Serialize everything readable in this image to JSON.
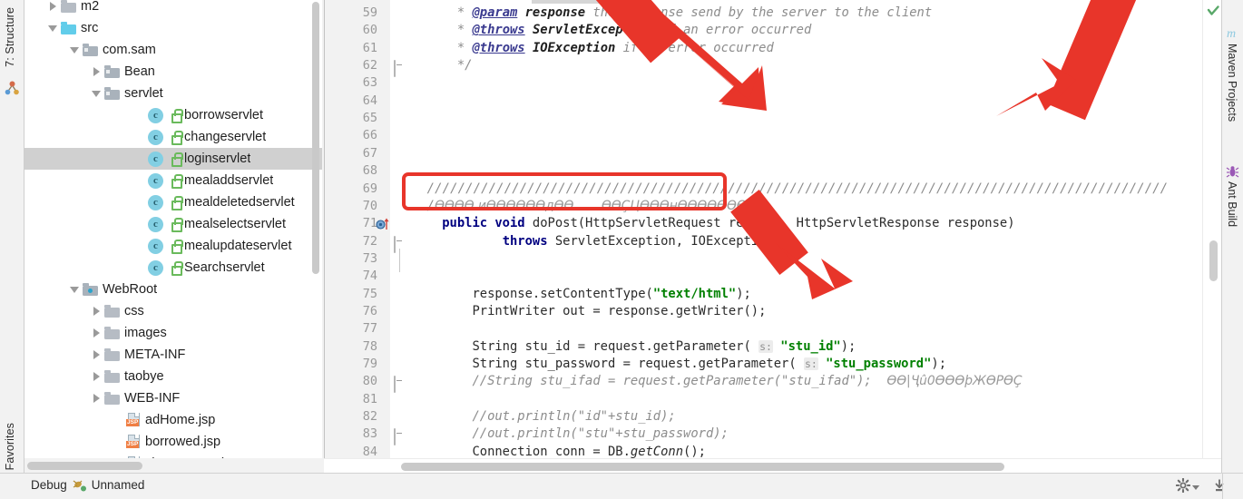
{
  "left_toolwindows": {
    "structure": "7: Structure",
    "favorites": "Favorites",
    "structure_icon": "structure-icon"
  },
  "right_toolwindows": {
    "maven": "Maven Projects",
    "ant": "Ant Build",
    "maven_icon": "maven-m-icon",
    "ant_icon": "ant-bug-icon"
  },
  "project_tree": {
    "items": [
      {
        "label": "m2",
        "indent": 1,
        "twisty": "collapsed",
        "icon": "folder-icon",
        "selected": false,
        "clipped": true
      },
      {
        "label": "src",
        "indent": 1,
        "twisty": "expanded",
        "icon": "folder-source-icon",
        "selected": false
      },
      {
        "label": "com.sam",
        "indent": 2,
        "twisty": "expanded",
        "icon": "package-icon",
        "selected": false
      },
      {
        "label": "Bean",
        "indent": 3,
        "twisty": "collapsed",
        "icon": "package-icon",
        "selected": false
      },
      {
        "label": "servlet",
        "indent": 3,
        "twisty": "expanded",
        "icon": "package-icon",
        "selected": false
      },
      {
        "label": "borrowservlet",
        "indent": 5,
        "twisty": "none",
        "icon": "java-class-icon",
        "selected": false
      },
      {
        "label": "changeservlet",
        "indent": 5,
        "twisty": "none",
        "icon": "java-class-icon",
        "selected": false
      },
      {
        "label": "loginservlet",
        "indent": 5,
        "twisty": "none",
        "icon": "java-class-icon",
        "selected": true
      },
      {
        "label": "mealaddservlet",
        "indent": 5,
        "twisty": "none",
        "icon": "java-class-icon",
        "selected": false
      },
      {
        "label": "mealdeletedservlet",
        "indent": 5,
        "twisty": "none",
        "icon": "java-class-icon",
        "selected": false
      },
      {
        "label": "mealselectservlet",
        "indent": 5,
        "twisty": "none",
        "icon": "java-class-icon",
        "selected": false
      },
      {
        "label": "mealupdateservlet",
        "indent": 5,
        "twisty": "none",
        "icon": "java-class-icon",
        "selected": false
      },
      {
        "label": "Searchservlet",
        "indent": 5,
        "twisty": "none",
        "icon": "java-class-icon",
        "selected": false
      },
      {
        "label": "WebRoot",
        "indent": 2,
        "twisty": "expanded",
        "icon": "folder-webroot-icon",
        "selected": false
      },
      {
        "label": "css",
        "indent": 3,
        "twisty": "collapsed",
        "icon": "folder-icon",
        "selected": false
      },
      {
        "label": "images",
        "indent": 3,
        "twisty": "collapsed",
        "icon": "folder-icon",
        "selected": false
      },
      {
        "label": "META-INF",
        "indent": 3,
        "twisty": "collapsed",
        "icon": "folder-icon",
        "selected": false
      },
      {
        "label": "taobye",
        "indent": 3,
        "twisty": "collapsed",
        "icon": "folder-icon",
        "selected": false
      },
      {
        "label": "WEB-INF",
        "indent": 3,
        "twisty": "collapsed",
        "icon": "folder-icon",
        "selected": false
      },
      {
        "label": "adHome.jsp",
        "indent": 4,
        "twisty": "none",
        "icon": "jsp-file-icon",
        "selected": false
      },
      {
        "label": "borrowed.jsp",
        "indent": 4,
        "twisty": "none",
        "icon": "jsp-file-icon",
        "selected": false
      },
      {
        "label": "changepage.jsp",
        "indent": 4,
        "twisty": "none",
        "icon": "jsp-file-icon",
        "selected": false,
        "clipped": true
      }
    ]
  },
  "editor": {
    "first_line_number": 59,
    "lines": [
      {
        "n": 59,
        "html": "      <span class='cmt'>* </span><span class='tag'>@param</span><span class='cmt'> </span><span class='tagv'>response</span><span class='cmt'> the response send by the server to the client</span>"
      },
      {
        "n": 60,
        "html": "      <span class='cmt'>* </span><span class='tag'>@throws</span><span class='cmt'> </span><span class='tagv'>ServletException</span><span class='cmt'> if an error occurred</span>"
      },
      {
        "n": 61,
        "html": "      <span class='cmt'>* </span><span class='tag'>@throws</span><span class='cmt'> </span><span class='tagv'>IOException</span><span class='cmt'> if an error occurred</span>"
      },
      {
        "n": 62,
        "html": "      <span class='cmt'>*/</span>"
      },
      {
        "n": 63,
        "html": ""
      },
      {
        "n": 64,
        "html": ""
      },
      {
        "n": 65,
        "html": ""
      },
      {
        "n": 66,
        "html": ""
      },
      {
        "n": 67,
        "html": ""
      },
      {
        "n": 68,
        "html": ""
      },
      {
        "n": 69,
        "html": "  <span class='slashes'>////////////////////////////////////////////////////////////////////////////////////////////////</span>"
      },
      {
        "n": 70,
        "html": "  <span class='slashes'>/</span><span class='moji'>ӨӨӨӨ иӨӨӨӨӨӨдӨӨ&nbsp;&nbsp;&nbsp;&nbsp;&nbsp;&nbsp;&nbsp;ӨӨÇЦӨӨӨнӨӨӨӨӨӨӨӨ</span>"
      },
      {
        "n": 71,
        "html": "    <span class='kw'>public void</span> doPost(HttpServletRequest request, HttpServletResponse response)"
      },
      {
        "n": 72,
        "html": "            <span class='kw'>throws</span> ServletException, IOException {"
      },
      {
        "n": 73,
        "html": ""
      },
      {
        "n": 74,
        "html": ""
      },
      {
        "n": 75,
        "html": "        response.setContentType(<span class='str'>\"text/html\"</span>);"
      },
      {
        "n": 76,
        "html": "        PrintWriter out = response.getWriter();"
      },
      {
        "n": 77,
        "html": ""
      },
      {
        "n": 78,
        "html": "        String stu_id = request.getParameter( <span class='hint'>s:</span> <span class='str'>\"stu_id\"</span>);"
      },
      {
        "n": 79,
        "html": "        String stu_password = request.getParameter( <span class='hint'>s:</span> <span class='str'>\"stu_password\"</span>);"
      },
      {
        "n": 80,
        "html": "        <span class='cmt'>//String stu_ifad = request.getParameter(\"stu_ifad\");</span>  <span class='moji'>ӨӨ|Ҷû0ӨӨӨþЖӨΡӨÇ</span>"
      },
      {
        "n": 81,
        "html": ""
      },
      {
        "n": 82,
        "html": "        <span class='cmt'>//out.println(\"id\"+stu_id);</span>"
      },
      {
        "n": 83,
        "html": "        <span class='cmt'>//out.println(\"stu\"+stu_password);</span>"
      },
      {
        "n": 84,
        "html": "        Connection conn = DB.<span style='font-style:italic'>getConn</span>();"
      }
    ],
    "inspection_status": "ok-check-icon",
    "gutter_markers": {
      "override_line": 71,
      "fold_lines": [
        62,
        72,
        80,
        83
      ]
    }
  },
  "annotations": {
    "highlight_box": {
      "color": "#e8352a",
      "target_lines": "69-70"
    },
    "arrows": [
      {
        "name": "arrow-to-comment-block",
        "color": "#e8352a"
      },
      {
        "name": "arrow-to-right-comment",
        "color": "#e8352a"
      },
      {
        "name": "arrow-to-method-signature",
        "color": "#e8352a"
      }
    ]
  },
  "statusbar": {
    "debug_label": "Debug",
    "debug_icon": "bug-icon",
    "config_name": "Unnamed",
    "gear_icon": "gear-icon",
    "caret_icon": "chevron-down-icon",
    "download_icon": "install-update-icon"
  },
  "colors": {
    "accent_red": "#e8352a",
    "selection_gray": "#d0d0d0",
    "keyword_blue": "#000080",
    "string_green": "#008000",
    "comment_gray": "#8c8c8c",
    "panel_bg": "#f2f2f2"
  }
}
